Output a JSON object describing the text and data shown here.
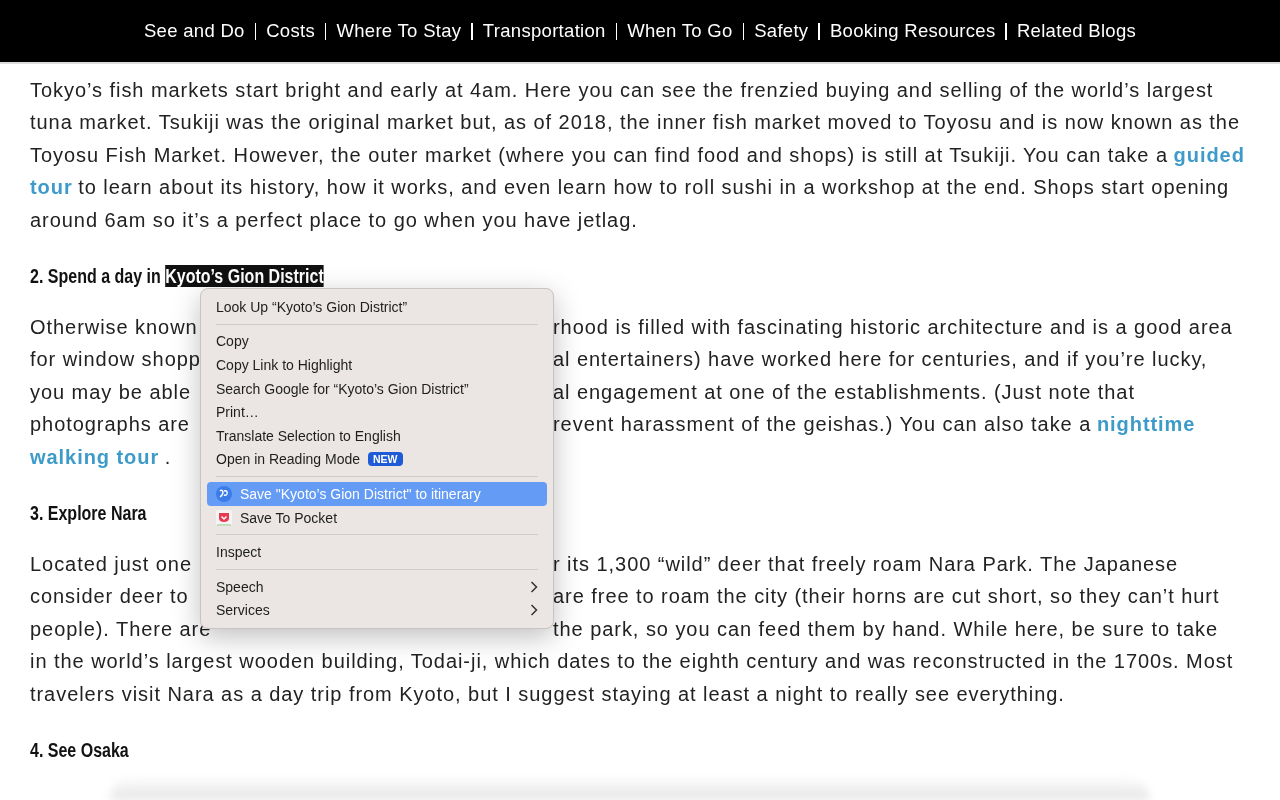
{
  "nav": [
    {
      "label": "See and Do"
    },
    {
      "label": "Costs"
    },
    {
      "label": "Where To Stay"
    },
    {
      "label": "Transportation"
    },
    {
      "label": "When To Go"
    },
    {
      "label": "Safety"
    },
    {
      "label": "Booking Resources"
    },
    {
      "label": "Related Blogs"
    }
  ],
  "article": [
    {
      "kind": "paragraph",
      "lines": [
        {
          "left": [
            {
              "text": "Tokyo’s fish markets start bright and early at 4am. Here you can see the frenzied buying and selling of the world’s largest",
              "link": false
            }
          ]
        },
        {
          "left": [
            {
              "text": "tuna market. Tsukiji was the original market but, as of 2018, the inner fish market moved to Toyosu and is now known as the",
              "link": false
            }
          ]
        },
        {
          "left": [
            {
              "text": "Toyosu Fish Market. However, the outer market (where you can find food and shops) is still at Tsukiji. You can take a",
              "link": false
            },
            {
              "text": "guided",
              "link": true
            }
          ]
        },
        {
          "left": [
            {
              "text": "tour",
              "link": true
            },
            {
              "text": "to learn about its history, how it works, and even learn how to roll sushi in a workshop at the end. Shops start opening",
              "link": false
            }
          ]
        },
        {
          "left": [
            {
              "text": "around 6am so it’s a perfect place to go when you have jetlag.",
              "link": false
            }
          ]
        }
      ]
    },
    {
      "kind": "heading",
      "parts": [
        {
          "text": "2. Spend a day in",
          "highlighted": false
        },
        {
          "text": "Kyoto’s Gion District",
          "highlighted": true
        }
      ]
    },
    {
      "kind": "paragraph",
      "lines": [
        {
          "left": [
            {
              "text": "Otherwise known",
              "link": false
            }
          ],
          "right": [
            {
              "text": "rhood is filled with fascinating historic architecture and is a good area",
              "link": false
            }
          ]
        },
        {
          "left": [
            {
              "text": "for window shopp",
              "link": false
            }
          ],
          "right": [
            {
              "text": "al entertainers) have worked here for centuries, and if you’re lucky,",
              "link": false
            }
          ]
        },
        {
          "left": [
            {
              "text": "you may be able",
              "link": false
            }
          ],
          "right": [
            {
              "text": "al engagement at one of the establishments. (Just note that",
              "link": false
            }
          ]
        },
        {
          "left": [
            {
              "text": "photographs are",
              "link": false
            }
          ],
          "right": [
            {
              "text": "revent harassment of the geishas.) You can also take a",
              "link": false
            },
            {
              "text": "nighttime",
              "link": true
            }
          ]
        },
        {
          "left": [
            {
              "text": "walking tour",
              "link": true
            },
            {
              "text": ".",
              "link": false
            }
          ]
        }
      ]
    },
    {
      "kind": "heading",
      "parts": [
        {
          "text": "3. Explore Nara",
          "highlighted": false
        }
      ]
    },
    {
      "kind": "paragraph",
      "lines": [
        {
          "left": [
            {
              "text": "Located just one",
              "link": false
            }
          ],
          "right": [
            {
              "text": "r its 1,300 “wild” deer that freely roam Nara Park. The Japanese",
              "link": false
            }
          ]
        },
        {
          "left": [
            {
              "text": "consider deer to",
              "link": false
            }
          ],
          "right": [
            {
              "text": "are free to roam the city (their horns are cut short, so they can’t hurt",
              "link": false
            }
          ]
        },
        {
          "left": [
            {
              "text": "people). There are",
              "link": false
            }
          ],
          "right": [
            {
              "text": "the park, so you can feed them by hand. While here, be sure to take",
              "link": false
            }
          ]
        },
        {
          "left": [
            {
              "text": "in the world’s largest wooden building, Todai-ji, which dates to the eighth century and was reconstructed in the 1700s. Most",
              "link": false
            }
          ]
        },
        {
          "left": [
            {
              "text": "travelers visit Nara as a day trip from Kyoto, but I suggest staying at least a night to really see everything.",
              "link": false
            }
          ]
        }
      ]
    },
    {
      "kind": "heading",
      "parts": [
        {
          "text": "4. See Osaka",
          "highlighted": false
        }
      ]
    }
  ],
  "menu": {
    "items": [
      {
        "kind": "item",
        "label": "Look Up “Kyoto’s Gion District”",
        "selected": false
      },
      {
        "kind": "separator"
      },
      {
        "kind": "item",
        "label": "Copy",
        "selected": false
      },
      {
        "kind": "item",
        "label": "Copy Link to Highlight",
        "selected": false
      },
      {
        "kind": "item",
        "label": "Search Google for “Kyoto’s Gion District”",
        "selected": false
      },
      {
        "kind": "item",
        "label": "Print…",
        "selected": false
      },
      {
        "kind": "item",
        "label": "Translate Selection to English",
        "selected": false
      },
      {
        "kind": "item",
        "label": "Open in Reading Mode",
        "badge": "NEW",
        "selected": false
      },
      {
        "kind": "separator"
      },
      {
        "kind": "extension",
        "label": "Save \"Kyoto’s Gion District\" to itinerary",
        "selected": true
      },
      {
        "kind": "extension",
        "label": "Save To Pocket",
        "selected": false
      },
      {
        "kind": "separator"
      },
      {
        "kind": "item",
        "label": "Inspect",
        "selected": false
      },
      {
        "kind": "separator"
      },
      {
        "kind": "submenu",
        "label": "Speech",
        "selected": false
      },
      {
        "kind": "submenu",
        "label": "Services",
        "selected": false
      }
    ]
  }
}
